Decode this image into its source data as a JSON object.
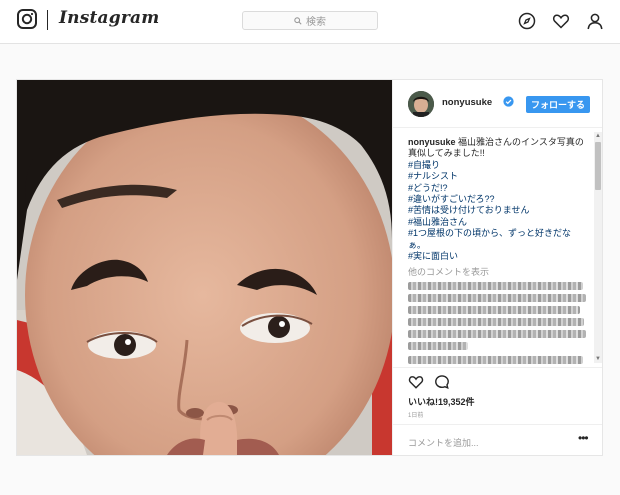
{
  "app": {
    "logo_text": "Instagram"
  },
  "search": {
    "placeholder": "検索"
  },
  "post": {
    "username": "nonyusuke",
    "follow_label": "フォローする",
    "caption_user": "nonyusuke",
    "caption_text": "福山雅治さんのインスタ写真の真似してみました!!",
    "hashtags": [
      "#自撮り",
      "#ナルシスト",
      "#どうだ!?",
      "#違いがすごいだろ??",
      "#苦情は受け付けておりません",
      "#福山雅治さん",
      "#1つ屋根の下の頃から、ずっと好きだなぁ。",
      "#実に面白い"
    ],
    "more_comments": "他のコメントを表示",
    "likes": "いいね!19,352件",
    "time": "1日前",
    "comment_placeholder": "コメントを追加...",
    "options": "•••"
  }
}
